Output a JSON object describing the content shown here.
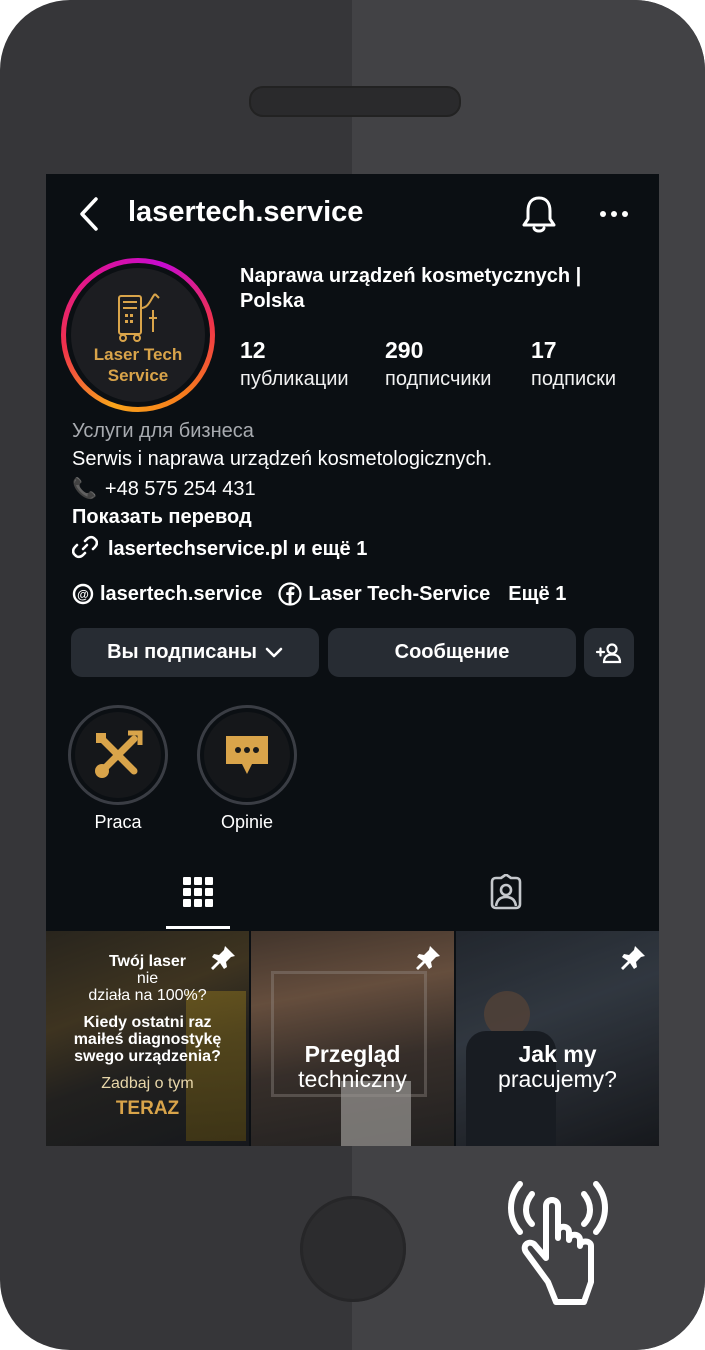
{
  "header": {
    "back_icon": "chevron-left-icon",
    "username": "lasertech.service",
    "bell_icon": "bell-icon",
    "more_icon": "more-horizontal-icon"
  },
  "profile": {
    "avatar_text_line1": "Laser Tech",
    "avatar_text_line2": "Service",
    "business_name": "Naprawa urządzeń kosmetycznych | Polska",
    "stats": [
      {
        "value": "12",
        "label": "публикации"
      },
      {
        "value": "290",
        "label": "подписчики"
      },
      {
        "value": "17",
        "label": "подписки"
      }
    ],
    "category": "Услуги для бизнеса",
    "bio": "Serwis i naprawa urządzeń kosmetologicznych.",
    "phone_emoji": "📞",
    "phone": "+48 575 254 431",
    "show_translation": "Показать перевод",
    "link": "lasertechservice.pl и ещё 1",
    "threads_handle": "lasertech.service",
    "facebook_name": "Laser Tech-Service",
    "more_links": "Ещё 1"
  },
  "actions": {
    "following_label": "Вы подписаны",
    "message_label": "Сообщение"
  },
  "highlights": [
    {
      "label": "Praca"
    },
    {
      "label": "Opinie"
    }
  ],
  "tabs": {
    "grid_icon": "grid-icon",
    "tagged_icon": "tagged-person-icon"
  },
  "posts": [
    {
      "line1": "Twój laser",
      "line2": "nie",
      "line3": "działa na 100%?",
      "line4": "Kiedy ostatni raz",
      "line5": "maiłeś diagnostykę",
      "line6": "swego urządzenia?",
      "line7": "Zadbaj o tym",
      "line8": "TERAZ"
    },
    {
      "title": "Przegląd",
      "subtitle": "techniczny"
    },
    {
      "title": "Jak my",
      "subtitle": "pracujemy?"
    }
  ],
  "colors": {
    "screen_bg": "#0b0f13",
    "button_bg": "#272c33",
    "gold": "#d9a44a"
  }
}
